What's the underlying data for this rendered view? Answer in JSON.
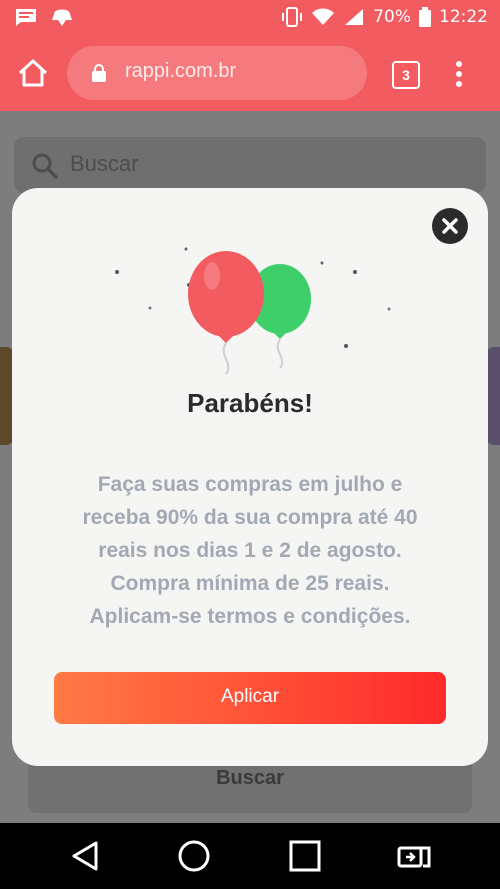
{
  "status_bar": {
    "battery": "70%",
    "time": "12:22",
    "icons": [
      "message-icon",
      "notification-icon",
      "vibrate-icon",
      "wifi-icon",
      "signal-icon",
      "battery-icon"
    ]
  },
  "browser": {
    "url": "rappi.com.br",
    "tab_count": "3",
    "icons": [
      "home-icon",
      "lock-icon",
      "tabs-icon",
      "menu-icon"
    ]
  },
  "page": {
    "search_placeholder": "Buscar",
    "bottom_button_label": "Buscar"
  },
  "modal": {
    "title": "Parabéns!",
    "body_lines": [
      "Faça suas compras em julho e",
      "receba 90% da sua compra até 40",
      "reais nos dias 1 e 2 de agosto.",
      "Compra mínima de 25 reais.",
      "Aplicam-se termos e condições."
    ],
    "apply_label": "Aplicar",
    "colors": {
      "balloon_red": "#f25b5f",
      "balloon_green": "#3ecf6a",
      "button_start": "#ff7a45",
      "button_end": "#ff2a2a"
    }
  },
  "nav_bar": {
    "icons": [
      "back-icon",
      "home-nav-icon",
      "recents-icon",
      "screen-rotate-icon"
    ]
  },
  "colors": {
    "brand": "#f25b5f"
  }
}
